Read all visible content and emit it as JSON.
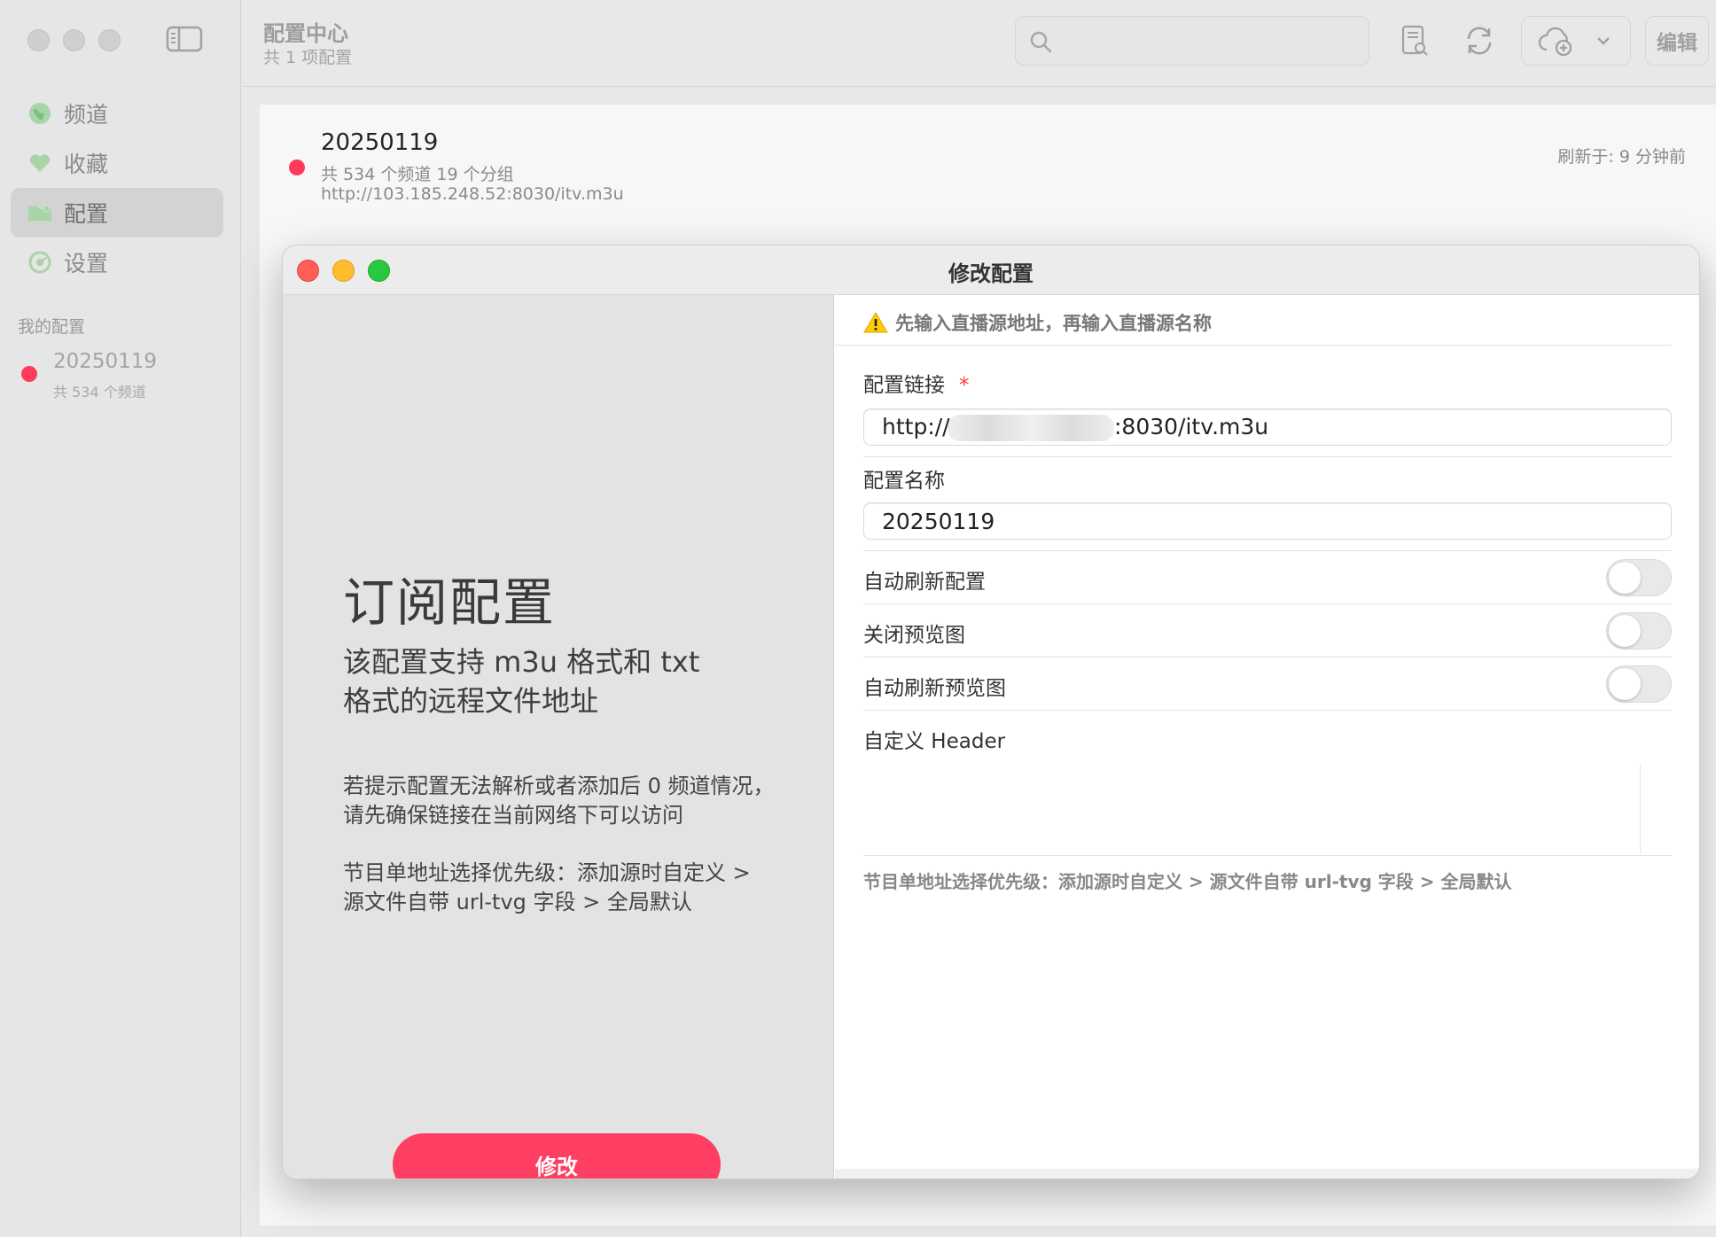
{
  "sidebar": {
    "nav": [
      {
        "label": "频道",
        "icon": "globe-icon",
        "active": false
      },
      {
        "label": "收藏",
        "icon": "heart-icon",
        "active": false
      },
      {
        "label": "配置",
        "icon": "folder-icon",
        "active": true
      },
      {
        "label": "设置",
        "icon": "gear-icon",
        "active": false
      }
    ],
    "section_title": "我的配置",
    "my_configs": [
      {
        "name": "20250119",
        "sub": "共 534 个频道"
      }
    ]
  },
  "toolbar": {
    "title": "配置中心",
    "subtitle": "共 1 项配置",
    "search_placeholder": "",
    "edit_label": "编辑"
  },
  "list": {
    "name": "20250119",
    "sub": "共 534 个频道  19 个分组",
    "url": "http://103.185.248.52:8030/itv.m3u",
    "refresh": "刷新于: 9 分钟前"
  },
  "modal": {
    "title": "修改配置",
    "left": {
      "heading": "订阅配置",
      "subheading": "该配置支持 m3u 格式和 txt 格式的远程文件地址",
      "para1": "若提示配置无法解析或者添加后 0 频道情况，请先确保链接在当前网络下可以访问",
      "para2": "节目单地址选择优先级：添加源时自定义 > 源文件自带 url-tvg 字段 > 全局默认",
      "button": "修改"
    },
    "right": {
      "warning": "先输入直播源地址，再输入直播源名称",
      "link_label": "配置链接",
      "required_mark": "*",
      "link_prefix": "http://",
      "link_suffix": ":8030/itv.m3u",
      "name_label": "配置名称",
      "name_value": "20250119",
      "toggles": [
        {
          "label": "自动刷新配置",
          "on": false
        },
        {
          "label": "关闭预览图",
          "on": false
        },
        {
          "label": "自动刷新预览图",
          "on": false
        }
      ],
      "header_label": "自定义 Header",
      "header_value": "",
      "footnote": "节目单地址选择优先级：添加源时自定义 > 源文件自带 url-tvg 字段 > 全局默认"
    }
  },
  "colors": {
    "accent": "#ff3e63",
    "status_dot": "#ff3b5c",
    "traffic_red": "#ff5f57",
    "traffic_yellow": "#febc2e",
    "traffic_green": "#28c840"
  }
}
